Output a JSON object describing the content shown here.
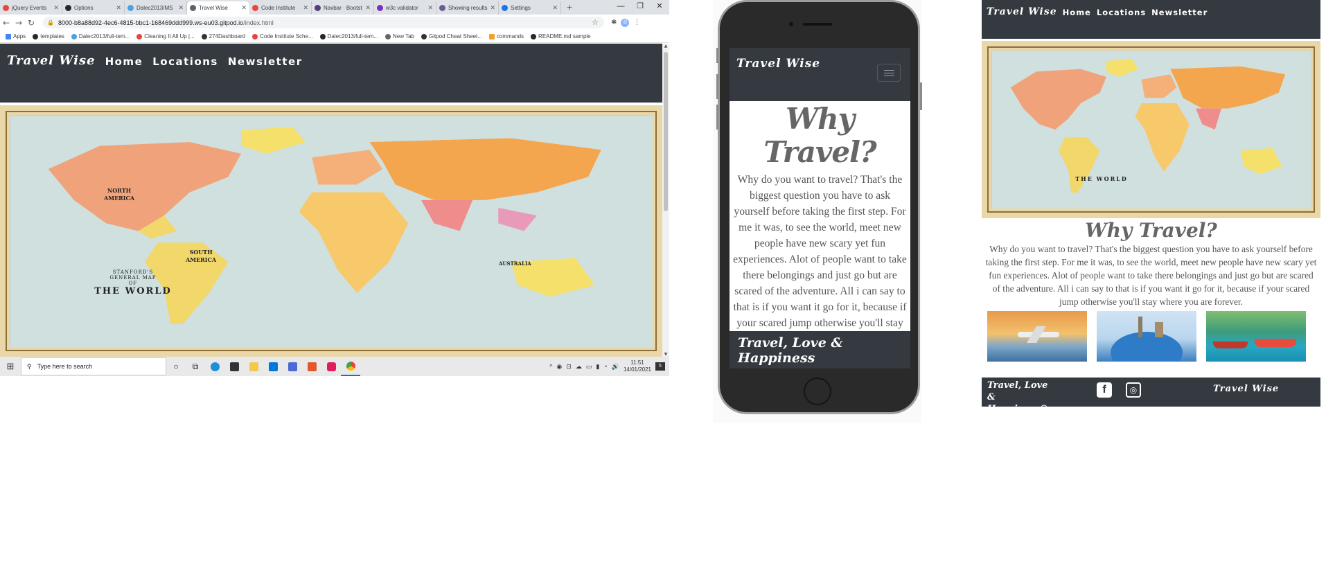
{
  "browser": {
    "tabs": [
      {
        "label": "jQuery Events",
        "color": "#e8453c"
      },
      {
        "label": "Options",
        "color": "#24292e"
      },
      {
        "label": "Dalec2013/MS",
        "color": "#4aa3df"
      },
      {
        "label": "Travel Wise",
        "color": "#5f6368"
      },
      {
        "label": "Code Institute",
        "color": "#e8453c"
      },
      {
        "label": "Navbar · Bootst",
        "color": "#563d7c"
      },
      {
        "label": "w3c validator",
        "color": "#7b2fbe"
      },
      {
        "label": "Showing results",
        "color": "#6b5b95"
      },
      {
        "label": "Settings",
        "color": "#1a73e8"
      }
    ],
    "active_tab": 3,
    "new_tab": "+",
    "window_controls": [
      "—",
      "❐",
      "✕"
    ],
    "url_host": "8000-b8a88d92-4ec6-4815-bbc1-168469ddd999.ws-eu03.gitpod.io",
    "url_path": "/index.html",
    "nav_back": "←",
    "nav_forward": "→",
    "nav_reload": "↻",
    "lock": "🔒",
    "star": "☆",
    "avatar": "d",
    "bookmarks": [
      {
        "label": "Apps",
        "color": "#4285f4"
      },
      {
        "label": "templates",
        "color": "#24292e"
      },
      {
        "label": "Dalec2013/full-tem...",
        "color": "#4aa3df"
      },
      {
        "label": "Cleaning It All Up |...",
        "color": "#e8453c"
      },
      {
        "label": "274Dashboard",
        "color": "#333333"
      },
      {
        "label": "Code Institute Sche...",
        "color": "#e8453c"
      },
      {
        "label": "Dalec2013/full-tem...",
        "color": "#24292e"
      },
      {
        "label": "New Tab",
        "color": "#666666"
      },
      {
        "label": "Gitpod Cheat Sheet...",
        "color": "#333333"
      },
      {
        "label": "commands",
        "color": "#f4a02a"
      },
      {
        "label": "README.md sample",
        "color": "#24292e"
      }
    ]
  },
  "site": {
    "brand": "Travel Wise",
    "nav": [
      "Home",
      "Locations",
      "Newsletter"
    ],
    "map": {
      "north_america": "NORTH\nAMERICA",
      "south_america": "SOUTH\nAMERICA",
      "australia": "AUSTRALIA",
      "subtitle": "STANFORD'S\nGENERAL MAP\nOF",
      "title": "THE WORLD"
    },
    "heading": "Why Travel?",
    "intro": "Why do you want to travel? That's the biggest question you have to ask yourself before taking the first step. For me it was, to see the world, meet new people have new scary yet fun experiences. Alot of people want to take there belongings and just go but are scared of the adventure. All i can say to that is if you want it go for it, because if your scared jump otherwise you'll stay where you are forever.",
    "footer_tagline": "Travel, Love & Happiness",
    "footer_tagline_emoji": "Travel, Love & Happiness☺",
    "colors": {
      "nav": "#343a40",
      "heading": "#666666"
    }
  },
  "taskbar": {
    "start": "⊞",
    "search_placeholder": "Type here to search",
    "time": "11:51",
    "date": "14/01/2021",
    "notifications": "5",
    "tray": [
      "^",
      "◉",
      "⊡",
      "☁",
      "▭",
      "▮",
      "◔",
      "🔊"
    ]
  },
  "icons": {
    "search": "⚲",
    "cortana": "○",
    "taskview": "⧉",
    "puzzle": "✱",
    "menu": "⋮",
    "facebook": "f",
    "instagram": "◎"
  }
}
